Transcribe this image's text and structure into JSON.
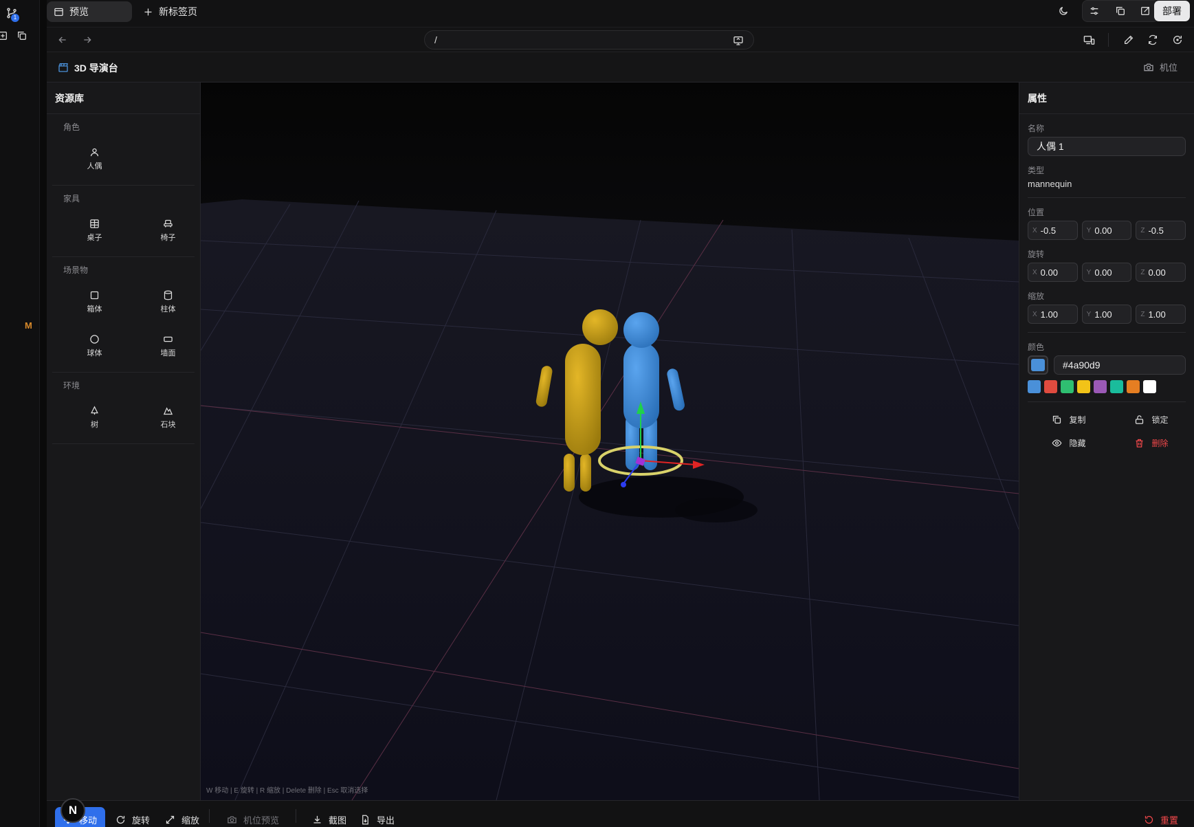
{
  "browser": {
    "tabs": [
      {
        "label": "预览",
        "icon": "window-icon",
        "active": true
      },
      {
        "label": "新标签页",
        "icon": "plus-icon",
        "active": false
      }
    ],
    "deploy_label": "部署",
    "url": "/",
    "badge_count": "1",
    "side_letter": "M"
  },
  "app": {
    "title": "3D 导演台",
    "camera_label": "机位"
  },
  "resource_panel": {
    "title": "资源库",
    "sections": [
      {
        "title": "角色",
        "items": [
          {
            "label": "人偶",
            "icon": "person-icon"
          }
        ]
      },
      {
        "title": "家具",
        "items": [
          {
            "label": "桌子",
            "icon": "table-icon"
          },
          {
            "label": "椅子",
            "icon": "chair-icon"
          }
        ]
      },
      {
        "title": "场景物",
        "items": [
          {
            "label": "箱体",
            "icon": "box-icon"
          },
          {
            "label": "柱体",
            "icon": "cylinder-icon"
          },
          {
            "label": "球体",
            "icon": "sphere-icon"
          },
          {
            "label": "墙面",
            "icon": "wall-icon"
          }
        ]
      },
      {
        "title": "环境",
        "items": [
          {
            "label": "树",
            "icon": "tree-icon"
          },
          {
            "label": "石块",
            "icon": "rock-icon"
          }
        ]
      }
    ]
  },
  "viewport": {
    "hint": "W 移动 | E 旋转 | R 缩放 | Delete 删除 | Esc 取消选择"
  },
  "properties": {
    "title": "属性",
    "name_label": "名称",
    "name_value": "人偶 1",
    "type_label": "类型",
    "type_value": "mannequin",
    "position_label": "位置",
    "position": {
      "x": "-0.5",
      "y": "0.00",
      "z": "-0.5"
    },
    "rotation_label": "旋转",
    "rotation": {
      "x": "0.00",
      "y": "0.00",
      "z": "0.00"
    },
    "scale_label": "缩放",
    "scale": {
      "x": "1.00",
      "y": "1.00",
      "z": "1.00"
    },
    "color_label": "颜色",
    "color_value": "#4a90d9",
    "swatches": [
      "#4a90d9",
      "#e04b3f",
      "#2fbf71",
      "#f2c318",
      "#9b59b6",
      "#1abc9c",
      "#e67e22",
      "#ffffff"
    ],
    "actions": {
      "duplicate": "复制",
      "lock": "锁定",
      "hide": "隐藏",
      "delete": "删除"
    }
  },
  "toolbar": {
    "move": "移动",
    "rotate": "旋转",
    "scale": "缩放",
    "camera_preview": "机位预览",
    "screenshot": "截图",
    "export": "导出",
    "reset": "重置",
    "n_badge": "N"
  },
  "colors": {
    "accent": "#2f6feb",
    "danger": "#f0474a",
    "selected_color": "#4a90d9",
    "mannequin2": "#c9a015"
  }
}
